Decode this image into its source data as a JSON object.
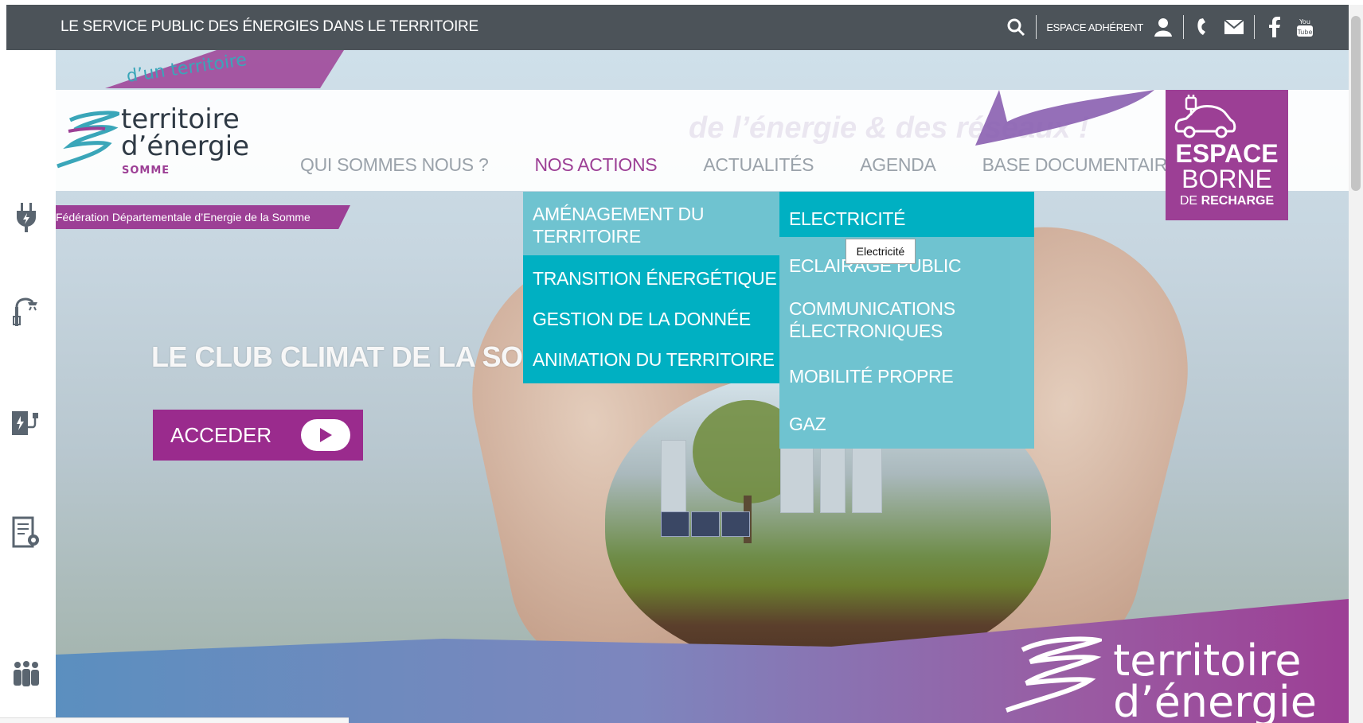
{
  "topbar": {
    "tagline": "LE SERVICE PUBLIC DES ÉNERGIES DANS LE TERRITOIRE",
    "member_label": "ESPACE ADHÉRENT",
    "youtube_label": "You Tube"
  },
  "logo": {
    "line1": "territoire",
    "line2": "d’énergie",
    "line3": "SOMME"
  },
  "header": {
    "subline": "Fédération Départementale d’Energie de la Somme",
    "faded_slogan": "de l’énergie & des réseaux !",
    "swoosh_text": "d’un territoire"
  },
  "nav": {
    "items": [
      {
        "label": "QUI SOMMES NOUS ?"
      },
      {
        "label": "NOS ACTIONS"
      },
      {
        "label": "ACTUALITÉS"
      },
      {
        "label": "AGENDA"
      },
      {
        "label": "BASE DOCUMENTAIRE"
      }
    ]
  },
  "espace_borne": {
    "line1": "ESPACE",
    "line2": "BORNE",
    "line3_prefix": "DE",
    "line3_strong": "RECHARGE"
  },
  "dropdown_actions": {
    "items": [
      {
        "label": "AMÉNAGEMENT DU TERRITOIRE"
      },
      {
        "label": "TRANSITION ÉNERGÉTIQUE"
      },
      {
        "label": "GESTION DE LA DONNÉE"
      },
      {
        "label": "ANIMATION DU TERRITOIRE"
      }
    ]
  },
  "dropdown_amenagement": {
    "items": [
      {
        "label": "ELECTRICITÉ"
      },
      {
        "label": "ECLAIRAGE PUBLIC"
      },
      {
        "label": "COMMUNICATIONS ÉLECTRONIQUES"
      },
      {
        "label": "MOBILITÉ PROPRE"
      },
      {
        "label": "GAZ"
      }
    ]
  },
  "tooltip": "Electricité",
  "hero": {
    "title": "LE CLUB CLIMAT DE LA SO",
    "button_label": "ACCEDER",
    "brand_line1": "territoire",
    "brand_line2": "d’énergie"
  },
  "colors": {
    "topbar": "#4c5359",
    "accent_purple": "#9c3f95",
    "menu_teal": "#6fc3d0",
    "menu_teal_active": "#00b0c2"
  },
  "icons": {
    "topbar": [
      "search-icon",
      "user-icon",
      "phone-icon",
      "mail-icon",
      "facebook-icon",
      "youtube-icon"
    ],
    "sidebar": [
      "plug-icon",
      "streetlight-icon",
      "charging-station-icon",
      "document-settings-icon",
      "people-icon"
    ]
  }
}
